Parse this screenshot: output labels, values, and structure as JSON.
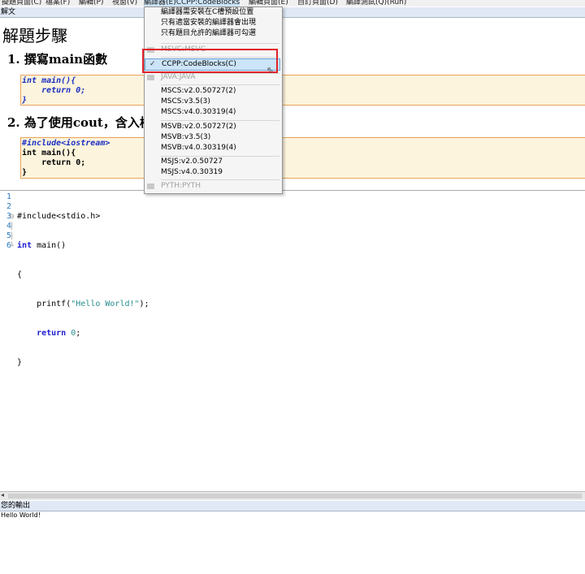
{
  "menubar": {
    "items": [
      "擬題頁面(C)",
      "檔案(F)",
      "編輯(P)",
      "視窗(V)",
      "編譯器(E)CCPP:CodeBlocks",
      "編輯頁面(E)",
      "自訂頁面(D)",
      "編譯測試(Q)(Run)"
    ]
  },
  "solution_panel": {
    "title": "解文",
    "heading": "解題步驟",
    "step1": "1. 撰寫main函數",
    "step1_code": [
      "int main(){",
      "    return 0;",
      "}"
    ],
    "step2": "2. 為了使用cout，含入標",
    "step2_code": [
      "#include<iostream>",
      "int main(){",
      "    return 0;",
      "}"
    ]
  },
  "editor": {
    "line_numbers": [
      "1",
      "2",
      "3",
      "4",
      "5",
      "6"
    ],
    "lines": {
      "l1": "#include<stdio.h>",
      "l2_kw": "int",
      "l2_rest": " main()",
      "l3": "{",
      "l4_pre": "    printf(",
      "l4_str": "\"Hello World!\"",
      "l4_post": ");",
      "l5_kw": "    return",
      "l5_num": " 0",
      "l5_post": ";",
      "l6": "}"
    }
  },
  "output_panel": {
    "title": "您的輸出",
    "text": "Hello World!"
  },
  "compiler_menu": {
    "header_items": [
      "編譯器需安裝在C槽預設位置",
      "只有適當安裝的編譯器會出現",
      "只有題目允許的編譯器可勾選"
    ],
    "msvc": "MSVC:MSVC",
    "ccpp": "CCPP:CodeBlocks(C)",
    "java": "JAVA:JAVA",
    "mscs": [
      "MSCS:v2.0.50727(2)",
      "MSCS:v3.5(3)",
      "MSCS:v4.0.30319(4)"
    ],
    "msvb": [
      "MSVB:v2.0.50727(2)",
      "MSVB:v3.5(3)",
      "MSVB:v4.0.30319(4)"
    ],
    "msjs": [
      "MSJS:v2.0.50727",
      "MSJS:v4.0.30319"
    ],
    "pyth": "PYTH:PYTH",
    "check_mark": "✓"
  }
}
